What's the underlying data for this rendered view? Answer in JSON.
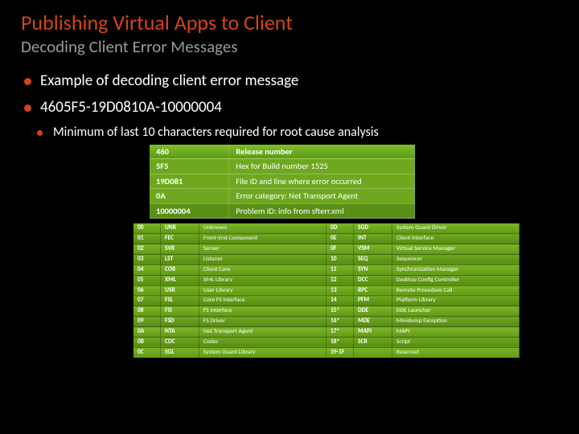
{
  "title": "Publishing Virtual Apps to Client",
  "subtitle": "Decoding Client Error Messages",
  "bullets": {
    "b1": "Example of decoding client error message",
    "b2": "4605F5-19D0810A-10000004",
    "b3": "Minimum of last 10 characters required for root cause analysis"
  },
  "decode": [
    {
      "k": "460",
      "v": "Release number"
    },
    {
      "k": "5F5",
      "v": "Hex for Build number 1525"
    },
    {
      "k": "19D081",
      "v": "File ID and line where error occurred"
    },
    {
      "k": "0A",
      "v": "Error category: Net Transport Agent"
    },
    {
      "k": "10000004",
      "v": "Problem ID: info from sfterr.xml"
    }
  ],
  "cats_left": [
    {
      "code": "00",
      "abbr": "UNK",
      "name": "Unknown"
    },
    {
      "code": "01",
      "abbr": "FEC",
      "name": "Front-End Component"
    },
    {
      "code": "02",
      "abbr": "SVR",
      "name": "Server"
    },
    {
      "code": "03",
      "abbr": "LST",
      "name": "Listener"
    },
    {
      "code": "04",
      "abbr": "COR",
      "name": "Client Core"
    },
    {
      "code": "05",
      "abbr": "XML",
      "name": "XML Library"
    },
    {
      "code": "06",
      "abbr": "USR",
      "name": "User Library"
    },
    {
      "code": "07",
      "abbr": "FSL",
      "name": "Core FS Interface"
    },
    {
      "code": "08",
      "abbr": "FSI",
      "name": "FS Interface"
    },
    {
      "code": "09",
      "abbr": "FSD",
      "name": "FS Driver"
    },
    {
      "code": "0A",
      "abbr": "NTA",
      "name": "Net Transport Agent"
    },
    {
      "code": "0B",
      "abbr": "CDC",
      "name": "Codec"
    },
    {
      "code": "0C",
      "abbr": "SGL",
      "name": "System Guard Library"
    }
  ],
  "cats_right": [
    {
      "code": "0D",
      "abbr": "SGD",
      "name": "System Guard Driver"
    },
    {
      "code": "0E",
      "abbr": "INT",
      "name": "Client Interface"
    },
    {
      "code": "0F",
      "abbr": "VSM",
      "name": "Virtual Service Manager"
    },
    {
      "code": "10",
      "abbr": "SEQ",
      "name": "Sequencer"
    },
    {
      "code": "11",
      "abbr": "SYN",
      "name": "Synchronization Manager"
    },
    {
      "code": "12",
      "abbr": "DCC",
      "name": "Desktop Config Controller"
    },
    {
      "code": "13",
      "abbr": "RPC",
      "name": "Remote Procedure Call"
    },
    {
      "code": "14",
      "abbr": "PFM",
      "name": "Platform Library"
    },
    {
      "code": "15*",
      "abbr": "DDE",
      "name": "DDE Launcher"
    },
    {
      "code": "16*",
      "abbr": "MDE",
      "name": "Minidump Exception"
    },
    {
      "code": "17*",
      "abbr": "MAPI",
      "name": "MAPI"
    },
    {
      "code": "18*",
      "abbr": "SCR",
      "name": "Script"
    },
    {
      "code": "19-1F",
      "abbr": "",
      "name": "Reserved"
    }
  ]
}
